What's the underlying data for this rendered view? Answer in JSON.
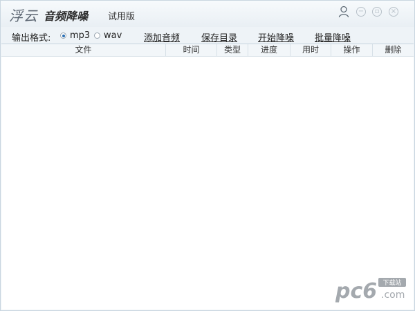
{
  "titlebar": {
    "brand": "浮云",
    "app_name": "音频降噪",
    "edition": "试用版"
  },
  "toolbar": {
    "format_label": "输出格式:",
    "format_options": [
      {
        "label": "mp3",
        "selected": true
      },
      {
        "label": "wav",
        "selected": false
      }
    ],
    "actions": [
      "添加音频",
      "保存目录",
      "开始降噪",
      "批量降噪"
    ]
  },
  "table": {
    "columns": [
      "文件",
      "时间",
      "类型",
      "进度",
      "用时",
      "操作",
      "删除"
    ],
    "rows": []
  },
  "watermark": {
    "brand": "pc6",
    "tag": "下载站",
    "domain": ".com"
  },
  "colors": {
    "window_bg": "#eef3f7",
    "accent": "#2a6fb4",
    "watermark": "#9aa0a6"
  }
}
